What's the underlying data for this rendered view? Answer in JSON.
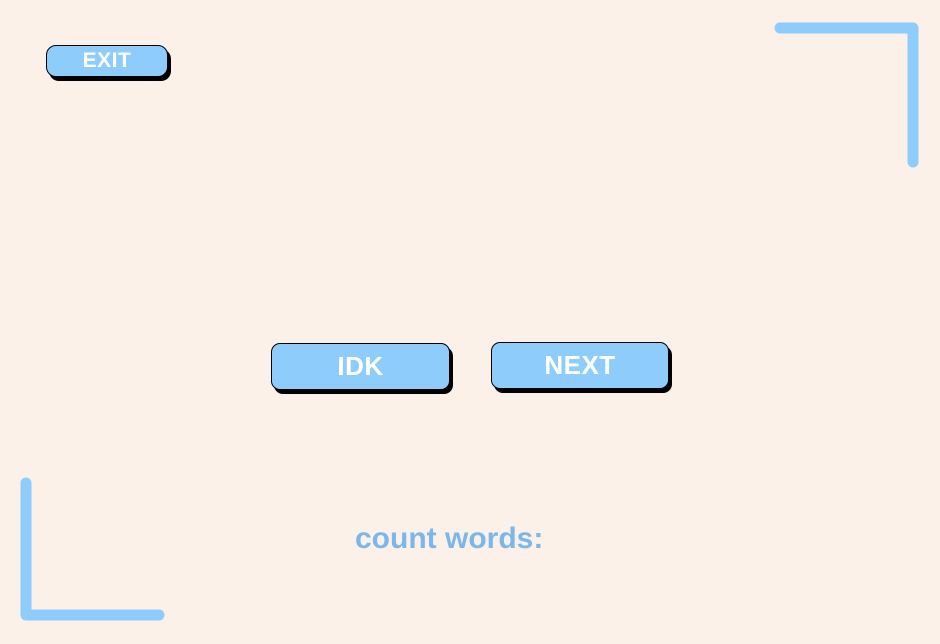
{
  "buttons": {
    "exit_label": "EXIT",
    "idk_label": "IDK",
    "next_label": "NEXT"
  },
  "count_label": "count words:",
  "colors": {
    "background": "#fbf1e8",
    "button_fill": "#8ecdfb",
    "corner_accent": "#8ecdfb",
    "label_text": "#7bb7ea"
  },
  "icons": {
    "top_right": "corner-bracket-top-right-icon",
    "bottom_left": "corner-bracket-bottom-left-icon"
  }
}
